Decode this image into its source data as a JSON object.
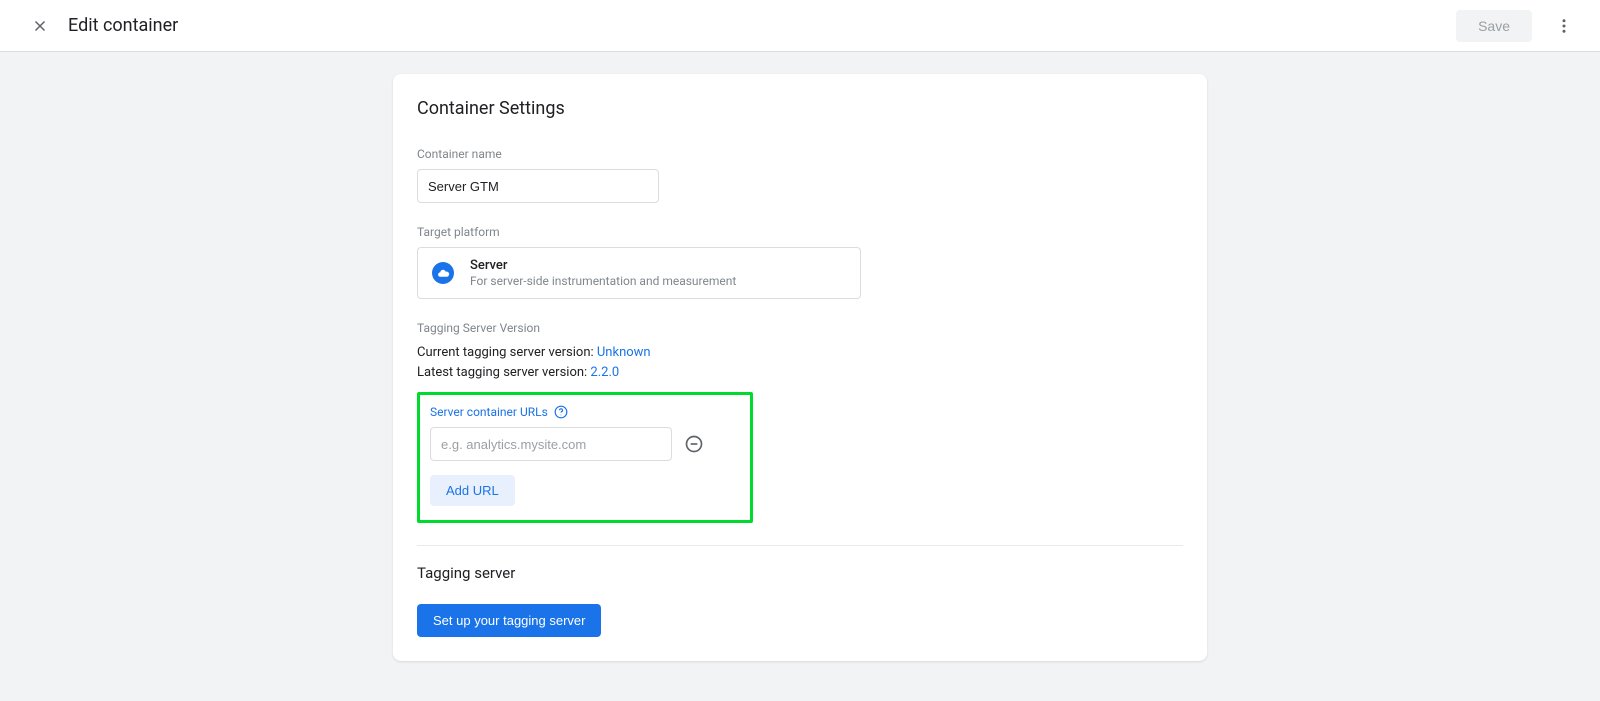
{
  "header": {
    "title": "Edit container",
    "save_label": "Save"
  },
  "card": {
    "heading": "Container Settings",
    "container_name_label": "Container name",
    "container_name_value": "Server GTM",
    "target_platform_label": "Target platform",
    "platform": {
      "title": "Server",
      "subtitle": "For server-side instrumentation and measurement"
    },
    "tagging_version_label": "Tagging Server Version",
    "current_version_text": "Current tagging server version: ",
    "current_version_value": "Unknown",
    "latest_version_text": "Latest tagging server version: ",
    "latest_version_value": "2.2.0",
    "urls_label": "Server container URLs",
    "url_placeholder": "e.g. analytics.mysite.com",
    "add_url_label": "Add URL",
    "tagging_server_heading": "Tagging server",
    "setup_button_label": "Set up your tagging server"
  }
}
